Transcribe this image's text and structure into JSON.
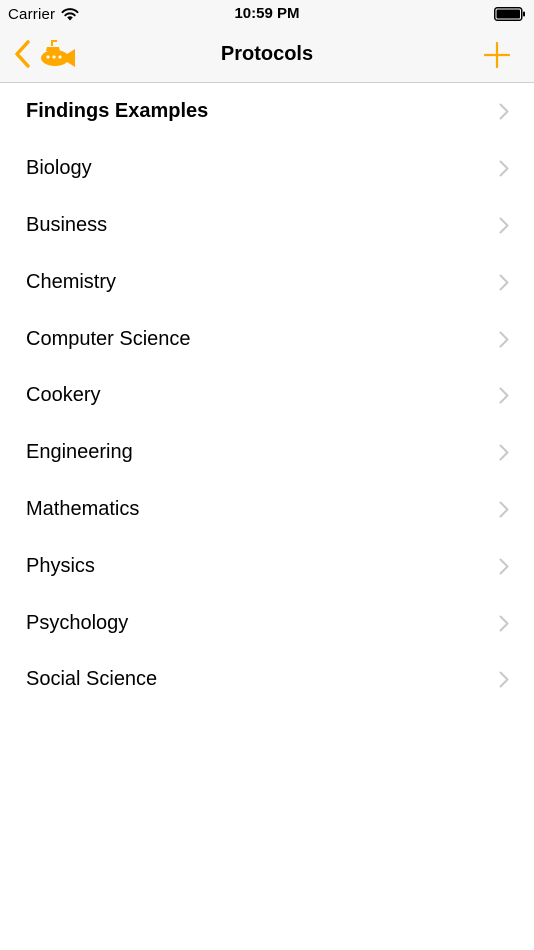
{
  "status_bar": {
    "carrier": "Carrier",
    "time": "10:59 PM"
  },
  "nav": {
    "title": "Protocols",
    "back_icon": "chevron-left-icon",
    "app_icon": "submarine-icon",
    "add_icon": "plus-icon"
  },
  "colors": {
    "accent": "#ffa800",
    "chevron": "#c7c7cc",
    "bar_background": "#f7f7f7"
  },
  "list": {
    "items": [
      {
        "label": "Findings Examples"
      },
      {
        "label": "Biology"
      },
      {
        "label": "Business"
      },
      {
        "label": "Chemistry"
      },
      {
        "label": "Computer Science"
      },
      {
        "label": "Cookery"
      },
      {
        "label": "Engineering"
      },
      {
        "label": "Mathematics"
      },
      {
        "label": "Physics"
      },
      {
        "label": "Psychology"
      },
      {
        "label": "Social Science"
      }
    ]
  }
}
